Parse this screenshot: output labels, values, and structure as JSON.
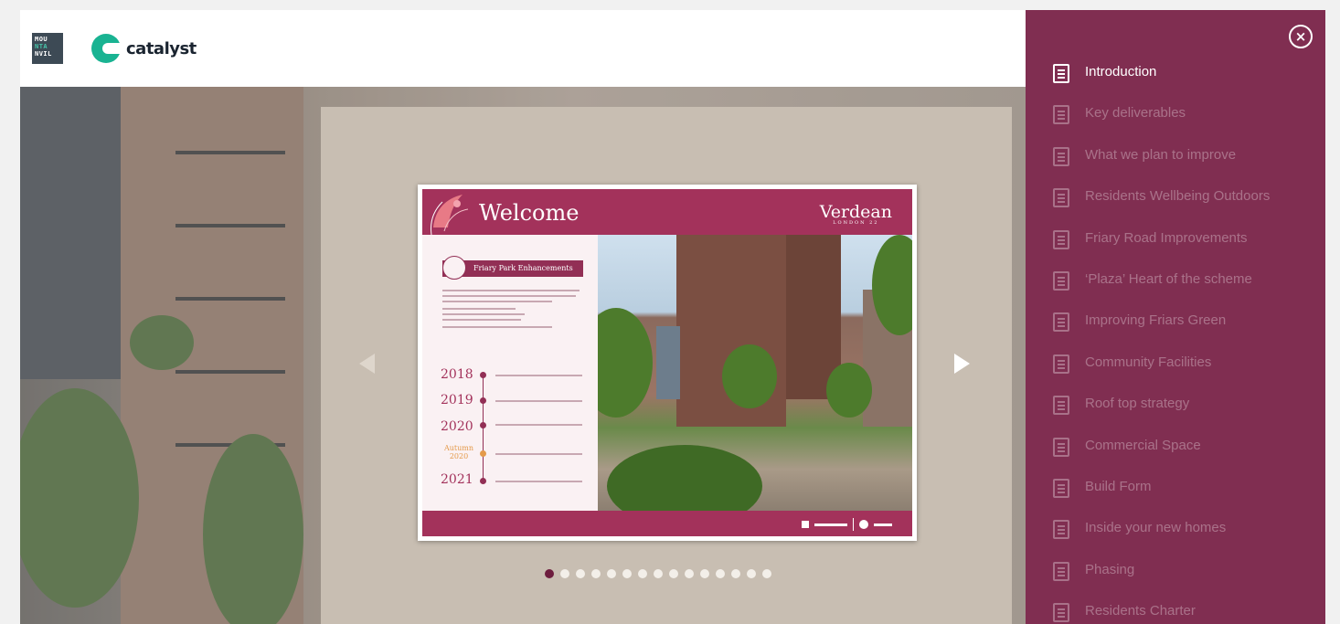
{
  "header": {
    "logo_mount": [
      "MOU",
      "NTA",
      "NVIL"
    ],
    "logo_catalyst": "catalyst"
  },
  "slide": {
    "welcome": "Welcome",
    "brand": "Verdean",
    "brand_sub": "LONDON 22",
    "panel_title": "Friary Park Enhancements",
    "timeline": [
      {
        "year": "2018"
      },
      {
        "year": "2019"
      },
      {
        "year": "2020"
      },
      {
        "year": "Autumn 2020"
      },
      {
        "year": "2021"
      }
    ]
  },
  "carousel": {
    "total_slides": 15,
    "active_index": 0
  },
  "menu": {
    "items": [
      {
        "label": "Introduction"
      },
      {
        "label": "Key deliverables"
      },
      {
        "label": "What we plan to improve"
      },
      {
        "label": "Residents Wellbeing Outdoors"
      },
      {
        "label": "Friary Road Improvements"
      },
      {
        "label": "‘Plaza’ Heart of the scheme"
      },
      {
        "label": "Improving Friars Green"
      },
      {
        "label": "Community Facilities"
      },
      {
        "label": "Roof top strategy"
      },
      {
        "label": "Commercial Space"
      },
      {
        "label": "Build Form"
      },
      {
        "label": "Inside your new homes"
      },
      {
        "label": "Phasing"
      },
      {
        "label": "Residents Charter"
      }
    ],
    "active_index": 0
  },
  "colors": {
    "menu_bg": "#761e44",
    "accent_pink": "#a3325b",
    "catalyst_green": "#19b392",
    "carousel_bg": "#c8beb2"
  }
}
